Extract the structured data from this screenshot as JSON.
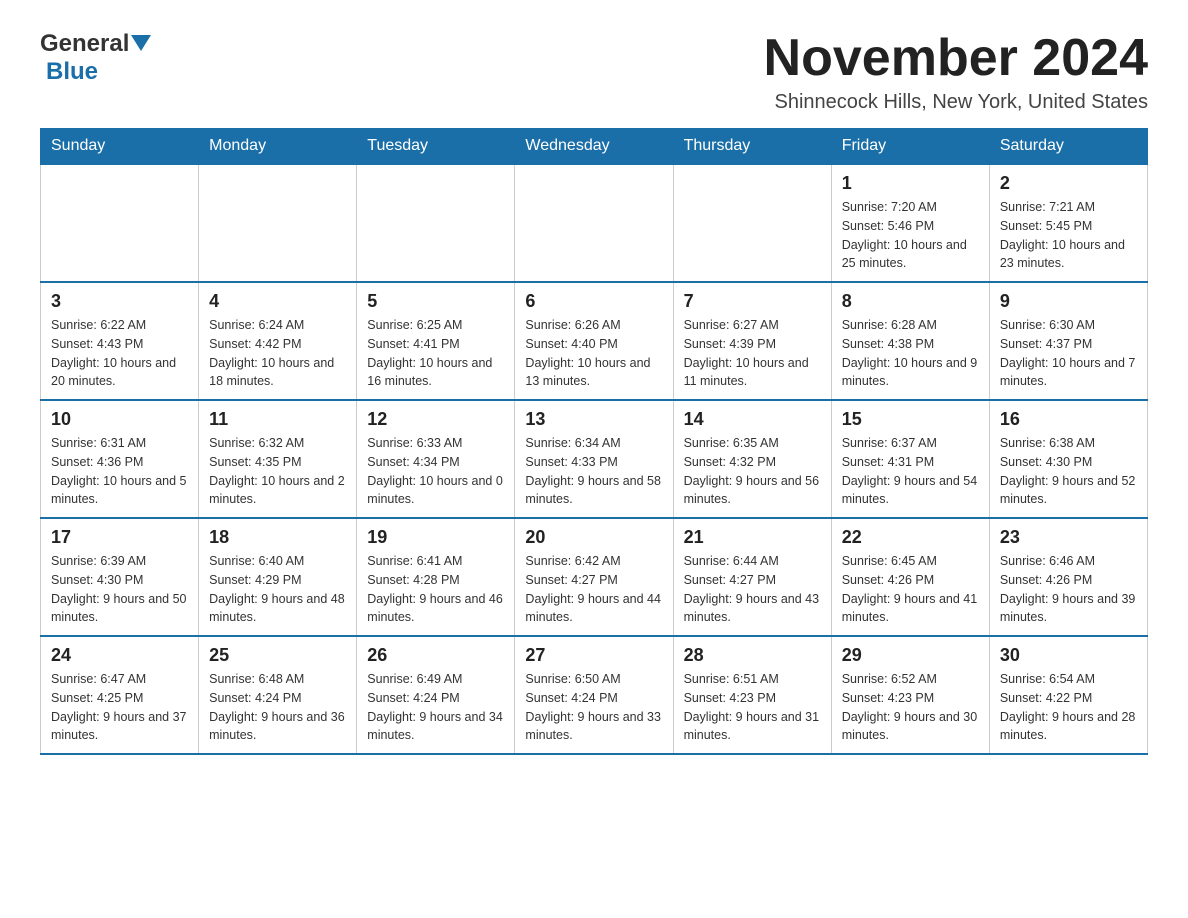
{
  "header": {
    "logo_general": "General",
    "logo_blue": "Blue",
    "month_title": "November 2024",
    "location": "Shinnecock Hills, New York, United States"
  },
  "days_of_week": [
    "Sunday",
    "Monday",
    "Tuesday",
    "Wednesday",
    "Thursday",
    "Friday",
    "Saturday"
  ],
  "weeks": [
    [
      {
        "day": "",
        "info": ""
      },
      {
        "day": "",
        "info": ""
      },
      {
        "day": "",
        "info": ""
      },
      {
        "day": "",
        "info": ""
      },
      {
        "day": "",
        "info": ""
      },
      {
        "day": "1",
        "info": "Sunrise: 7:20 AM\nSunset: 5:46 PM\nDaylight: 10 hours and 25 minutes."
      },
      {
        "day": "2",
        "info": "Sunrise: 7:21 AM\nSunset: 5:45 PM\nDaylight: 10 hours and 23 minutes."
      }
    ],
    [
      {
        "day": "3",
        "info": "Sunrise: 6:22 AM\nSunset: 4:43 PM\nDaylight: 10 hours and 20 minutes."
      },
      {
        "day": "4",
        "info": "Sunrise: 6:24 AM\nSunset: 4:42 PM\nDaylight: 10 hours and 18 minutes."
      },
      {
        "day": "5",
        "info": "Sunrise: 6:25 AM\nSunset: 4:41 PM\nDaylight: 10 hours and 16 minutes."
      },
      {
        "day": "6",
        "info": "Sunrise: 6:26 AM\nSunset: 4:40 PM\nDaylight: 10 hours and 13 minutes."
      },
      {
        "day": "7",
        "info": "Sunrise: 6:27 AM\nSunset: 4:39 PM\nDaylight: 10 hours and 11 minutes."
      },
      {
        "day": "8",
        "info": "Sunrise: 6:28 AM\nSunset: 4:38 PM\nDaylight: 10 hours and 9 minutes."
      },
      {
        "day": "9",
        "info": "Sunrise: 6:30 AM\nSunset: 4:37 PM\nDaylight: 10 hours and 7 minutes."
      }
    ],
    [
      {
        "day": "10",
        "info": "Sunrise: 6:31 AM\nSunset: 4:36 PM\nDaylight: 10 hours and 5 minutes."
      },
      {
        "day": "11",
        "info": "Sunrise: 6:32 AM\nSunset: 4:35 PM\nDaylight: 10 hours and 2 minutes."
      },
      {
        "day": "12",
        "info": "Sunrise: 6:33 AM\nSunset: 4:34 PM\nDaylight: 10 hours and 0 minutes."
      },
      {
        "day": "13",
        "info": "Sunrise: 6:34 AM\nSunset: 4:33 PM\nDaylight: 9 hours and 58 minutes."
      },
      {
        "day": "14",
        "info": "Sunrise: 6:35 AM\nSunset: 4:32 PM\nDaylight: 9 hours and 56 minutes."
      },
      {
        "day": "15",
        "info": "Sunrise: 6:37 AM\nSunset: 4:31 PM\nDaylight: 9 hours and 54 minutes."
      },
      {
        "day": "16",
        "info": "Sunrise: 6:38 AM\nSunset: 4:30 PM\nDaylight: 9 hours and 52 minutes."
      }
    ],
    [
      {
        "day": "17",
        "info": "Sunrise: 6:39 AM\nSunset: 4:30 PM\nDaylight: 9 hours and 50 minutes."
      },
      {
        "day": "18",
        "info": "Sunrise: 6:40 AM\nSunset: 4:29 PM\nDaylight: 9 hours and 48 minutes."
      },
      {
        "day": "19",
        "info": "Sunrise: 6:41 AM\nSunset: 4:28 PM\nDaylight: 9 hours and 46 minutes."
      },
      {
        "day": "20",
        "info": "Sunrise: 6:42 AM\nSunset: 4:27 PM\nDaylight: 9 hours and 44 minutes."
      },
      {
        "day": "21",
        "info": "Sunrise: 6:44 AM\nSunset: 4:27 PM\nDaylight: 9 hours and 43 minutes."
      },
      {
        "day": "22",
        "info": "Sunrise: 6:45 AM\nSunset: 4:26 PM\nDaylight: 9 hours and 41 minutes."
      },
      {
        "day": "23",
        "info": "Sunrise: 6:46 AM\nSunset: 4:26 PM\nDaylight: 9 hours and 39 minutes."
      }
    ],
    [
      {
        "day": "24",
        "info": "Sunrise: 6:47 AM\nSunset: 4:25 PM\nDaylight: 9 hours and 37 minutes."
      },
      {
        "day": "25",
        "info": "Sunrise: 6:48 AM\nSunset: 4:24 PM\nDaylight: 9 hours and 36 minutes."
      },
      {
        "day": "26",
        "info": "Sunrise: 6:49 AM\nSunset: 4:24 PM\nDaylight: 9 hours and 34 minutes."
      },
      {
        "day": "27",
        "info": "Sunrise: 6:50 AM\nSunset: 4:24 PM\nDaylight: 9 hours and 33 minutes."
      },
      {
        "day": "28",
        "info": "Sunrise: 6:51 AM\nSunset: 4:23 PM\nDaylight: 9 hours and 31 minutes."
      },
      {
        "day": "29",
        "info": "Sunrise: 6:52 AM\nSunset: 4:23 PM\nDaylight: 9 hours and 30 minutes."
      },
      {
        "day": "30",
        "info": "Sunrise: 6:54 AM\nSunset: 4:22 PM\nDaylight: 9 hours and 28 minutes."
      }
    ]
  ],
  "colors": {
    "header_bg": "#1a6fa8",
    "header_text": "#ffffff",
    "border": "#1a6fa8",
    "cell_border": "#cccccc"
  }
}
